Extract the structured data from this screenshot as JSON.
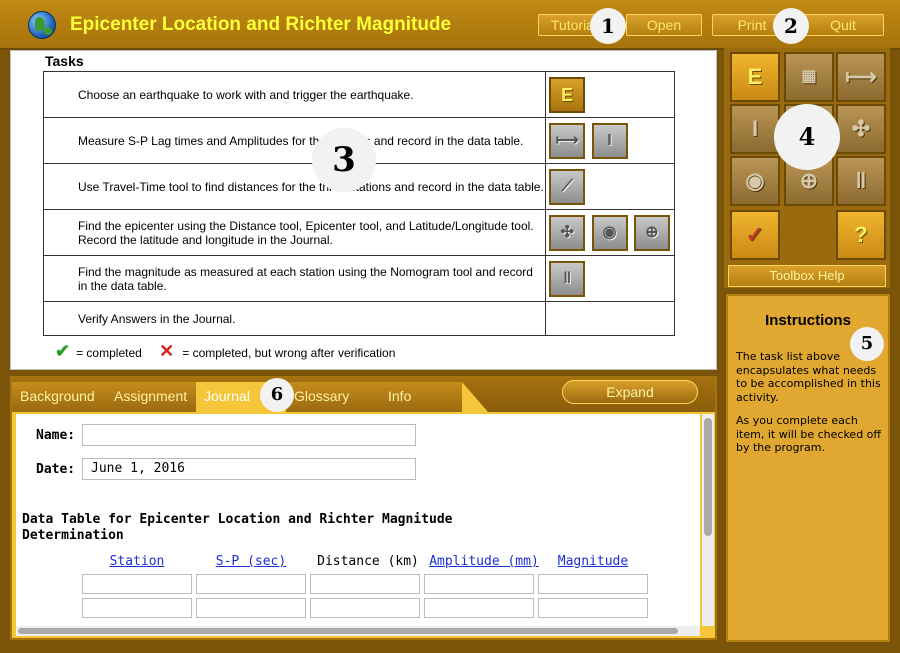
{
  "app": {
    "title": "Epicenter Location and Richter Magnitude",
    "buttons": {
      "tutorial": "Tutorial",
      "open": "Open",
      "print": "Print",
      "quit": "Quit"
    }
  },
  "badges": [
    "1",
    "2",
    "3",
    "4",
    "5",
    "6"
  ],
  "tasks": {
    "title": "Tasks",
    "rows": [
      {
        "text": "Choose an earthquake to work with and trigger the earthquake.",
        "icons": [
          "earthquake-icon"
        ]
      },
      {
        "text": "Measure S-P Lag times and Amplitudes for the stations and record in the data table.",
        "icons": [
          "sp-lag-icon",
          "amplitude-icon"
        ]
      },
      {
        "text": "Use Travel-Time tool to find distances for the three stations and record in the data table.",
        "icons": [
          "travel-time-icon"
        ]
      },
      {
        "text": "Find the epicenter using the Distance tool, Epicenter tool, and Latitude/Longitude tool. Record the latitude and longitude in the Journal.",
        "icons": [
          "distance-circles-icon",
          "epicenter-icon",
          "globe-grid-icon"
        ]
      },
      {
        "text": "Find the magnitude as measured at each station using the Nomogram tool and record in the data table.",
        "icons": [
          "nomogram-icon"
        ]
      },
      {
        "text": "Verify Answers in the Journal.",
        "icons": []
      }
    ],
    "legend": {
      "completed": "= completed",
      "wrong": "= completed, but wrong after verification"
    }
  },
  "tabs": {
    "items": [
      "Background",
      "Assignment",
      "Journal",
      "Glossary",
      "Info"
    ],
    "active": "Journal",
    "expand": "Expand"
  },
  "journal": {
    "name_label": "Name:",
    "name_value": "",
    "date_label": "Date:",
    "date_value": "June 1, 2016",
    "table_heading": "Data Table for Epicenter Location and Richter Magnitude Determination",
    "columns": [
      "Station",
      "S-P (sec)",
      "Distance (km)",
      "Amplitude (mm)",
      "Magnitude"
    ],
    "column_links": [
      true,
      true,
      false,
      true,
      true
    ],
    "rows": [
      [
        "",
        "",
        "",
        "",
        ""
      ],
      [
        "",
        "",
        "",
        "",
        ""
      ]
    ]
  },
  "toolbox": {
    "tools": [
      "earthquake-tool",
      "map-tool",
      "sp-lag-tool",
      "amplitude-tool",
      "blank-tool",
      "distance-circles-tool",
      "epicenter-tool",
      "globe-grid-tool",
      "nomogram-tool",
      "verify-tool",
      "help-tool"
    ],
    "help_label": "Toolbox Help"
  },
  "instructions": {
    "title": "Instructions",
    "paragraphs": [
      "The task list above encapsulates what needs to be accomplished in this activity.",
      "As you complete each item, it will be checked off by the program."
    ]
  }
}
